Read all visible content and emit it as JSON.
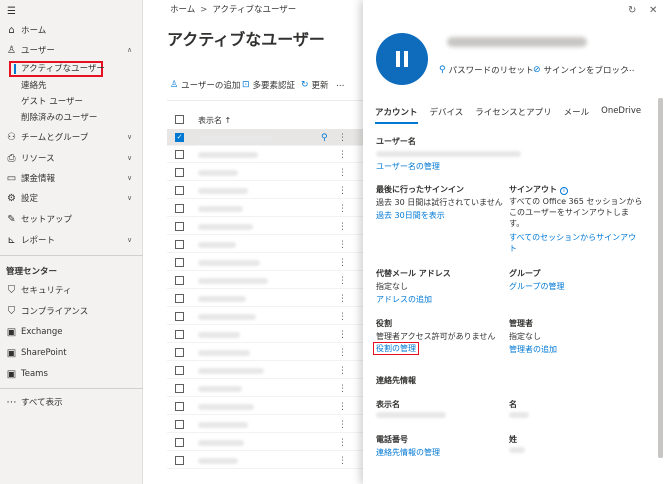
{
  "nav": {
    "menu_icon": "hamburger-icon",
    "items": [
      {
        "label": "ホーム",
        "icon": "home-icon"
      },
      {
        "label": "ユーザー",
        "icon": "person-icon",
        "expanded": true
      },
      {
        "label": "チームとグループ",
        "icon": "group-icon"
      },
      {
        "label": "リソース",
        "icon": "printer-icon"
      },
      {
        "label": "課金情報",
        "icon": "card-icon"
      },
      {
        "label": "設定",
        "icon": "gear-icon"
      },
      {
        "label": "セットアップ",
        "icon": "wrench-icon"
      },
      {
        "label": "レポート",
        "icon": "chart-icon"
      }
    ],
    "user_sub": [
      "アクティブなユーザー",
      "連絡先",
      "ゲスト ユーザー",
      "削除済みのユーザー"
    ],
    "admin_header": "管理センター",
    "admin_items": [
      {
        "label": "セキュリティ",
        "icon": "shield-icon"
      },
      {
        "label": "コンプライアンス",
        "icon": "compliance-icon"
      },
      {
        "label": "Exchange",
        "icon": "exchange-icon"
      },
      {
        "label": "SharePoint",
        "icon": "sharepoint-icon"
      },
      {
        "label": "Teams",
        "icon": "teams-icon"
      }
    ],
    "show_all": "すべて表示"
  },
  "main": {
    "breadcrumb": [
      "ホーム",
      "アクティブなユーザー"
    ],
    "title": "アクティブなユーザー",
    "commands": [
      {
        "label": "ユーザーの追加",
        "icon": "add-user-icon"
      },
      {
        "label": "多要素認証",
        "icon": "lock-icon"
      },
      {
        "label": "更新",
        "icon": "refresh-icon"
      }
    ],
    "more": "…",
    "column_display_name": "表示名 ↑"
  },
  "panel": {
    "actions": [
      {
        "label": "パスワードのリセット",
        "icon": "key-icon"
      },
      {
        "label": "サインインをブロック",
        "icon": "block-icon"
      }
    ],
    "more": "…",
    "tabs": [
      "アカウント",
      "デバイス",
      "ライセンスとアプリ",
      "メール",
      "OneDrive"
    ],
    "sections": {
      "username_title": "ユーザー名",
      "username_link": "ユーザー名の管理",
      "last_signin_title": "最後に行ったサインイン",
      "last_signin_value": "過去 30 日間は試行されていません",
      "last_signin_link": "過去 30日間を表示",
      "signout_title": "サインアウト",
      "signout_value": "すべての Office 365 セッションからこのユーザーをサインアウトします。",
      "signout_link": "すべてのセッションからサインアウト",
      "alias_title": "代替メール アドレス",
      "alias_value": "指定なし",
      "alias_link": "アドレスの追加",
      "groups_title": "グループ",
      "groups_link": "グループの管理",
      "roles_title": "役割",
      "roles_value": "管理者アクセス許可がありません",
      "roles_link": "役割の管理",
      "manager_title": "管理者",
      "manager_value": "指定なし",
      "manager_link": "管理者の追加",
      "contact_title": "連絡先情報",
      "displayname_title": "表示名",
      "firstname_title": "名",
      "phone_title": "電話番号",
      "lastname_title": "姓",
      "contact_link": "連絡先情報の管理"
    }
  }
}
